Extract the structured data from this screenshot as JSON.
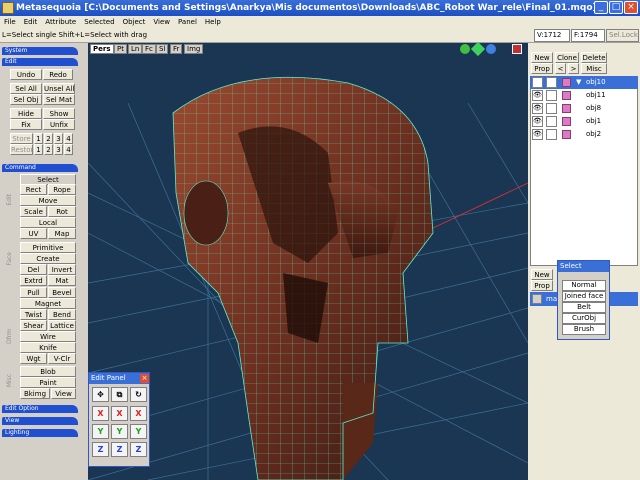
{
  "window": {
    "title": "Metasequoia [C:\\Documents and Settings\\Anarkya\\Mis documentos\\Downloads\\ABC_Robot War_rele\\Final_01.mqo]",
    "minimize": "_",
    "maximize": "□",
    "close": "×"
  },
  "menu": [
    "File",
    "Edit",
    "Attribute",
    "Selected",
    "Object",
    "View",
    "Panel",
    "Help"
  ],
  "status": {
    "hint": "L=Select single  Shift+L=Select with drag",
    "vertex_count": "V:1712",
    "face_count": "F:1794",
    "sel_lock": "Sel.Lock"
  },
  "left_panel": {
    "system": "System",
    "edit": "Edit",
    "undo": "Undo",
    "redo": "Redo",
    "sel_all": "Sel All",
    "unsel_all": "Unsel All",
    "sel_obj": "Sel Obj",
    "sel_mat": "Sel Mat",
    "hide": "Hide",
    "show": "Show",
    "fix": "Fix",
    "unfix": "Unfix",
    "store": "Store",
    "restore": "Restore",
    "slots": [
      "1",
      "2",
      "3",
      "4"
    ],
    "command": "Command",
    "select": "Select",
    "rect": "Rect",
    "rope": "Rope",
    "move": "Move",
    "scale": "Scale",
    "rot": "Rot",
    "local": "Local",
    "uv": "UV",
    "map": "Map",
    "primitive": "Primitive",
    "create": "Create",
    "del": "Del",
    "invert": "Invert",
    "extrd": "Extrd",
    "mat": "Mat",
    "pull": "Pull",
    "bevel": "Bevel",
    "magnet": "Magnet",
    "twist": "Twist",
    "bend": "Bend",
    "shear": "Shear",
    "lattice": "Lattice",
    "wire": "Wire",
    "knife": "Knife",
    "wgt": "Wgt",
    "vclr": "V-Clr",
    "blob": "Blob",
    "paint": "Paint",
    "bkimg": "Bkimg",
    "view": "View",
    "edit_option": "Edit Option",
    "view_sec": "View",
    "lighting": "Lighting",
    "vlabels": [
      "Edit",
      "Face",
      "Dfrm",
      "Misc"
    ]
  },
  "viewport": {
    "tabs": [
      "Pers",
      "Pt",
      "Ln",
      "Fc",
      "Sl",
      "Fr",
      "Img"
    ]
  },
  "right_panel": {
    "new": "New",
    "clone": "Clone",
    "delete": "Delete",
    "prop": "Prop",
    "prev": "<",
    "next": ">",
    "misc": "Misc",
    "objects": [
      "obj10",
      "obj11",
      "obj8",
      "obj1",
      "obj2"
    ],
    "material_new": "New",
    "material_prop": "Prop",
    "material_item": "ma"
  },
  "edit_panel": {
    "title": "Edit Panel",
    "rows": [
      [
        "X",
        "X",
        "X"
      ],
      [
        "Y",
        "Y",
        "Y"
      ],
      [
        "Z",
        "Z",
        "Z"
      ]
    ],
    "close": "×"
  },
  "select_popup": {
    "title": "Select",
    "options": [
      "Normal",
      "Joined face",
      "Belt",
      "CurObj",
      "Brush"
    ]
  },
  "colors": {
    "titlebar": "#2358cc",
    "viewport_bg": "#1a3652",
    "mesh_wire": "#5ef0d0",
    "surface": "#7a3a26",
    "section_header": "#2050d0"
  }
}
